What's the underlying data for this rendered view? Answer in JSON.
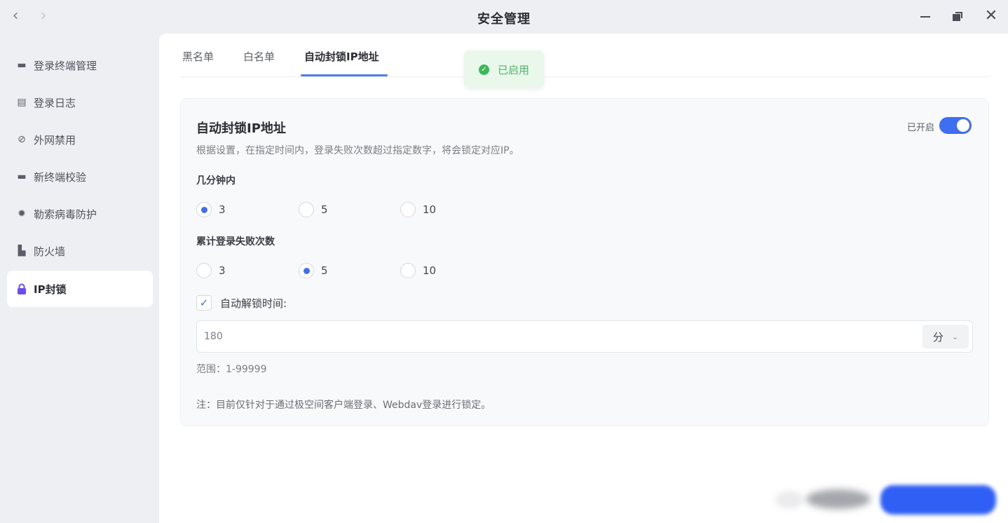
{
  "window": {
    "title": "安全管理",
    "back_icon": "‹",
    "forward_icon": "›",
    "close_icon": "✕"
  },
  "sidebar": {
    "items": [
      {
        "label": "登录终端管理",
        "icon": "monitor-icon",
        "glyph": "▬"
      },
      {
        "label": "登录日志",
        "icon": "log-icon",
        "glyph": "▤"
      },
      {
        "label": "外网禁用",
        "icon": "ban-icon",
        "glyph": "⊘"
      },
      {
        "label": "新终端校验",
        "icon": "chat-icon",
        "glyph": "▬"
      },
      {
        "label": "勒索病毒防护",
        "icon": "virus-icon",
        "glyph": "✹"
      },
      {
        "label": "防火墙",
        "icon": "firewall-icon",
        "glyph": "▙"
      },
      {
        "label": "IP封锁",
        "icon": "lock-icon",
        "glyph": "🔒"
      }
    ],
    "active_index": 6
  },
  "tabs": [
    {
      "label": "黑名单"
    },
    {
      "label": "白名单"
    },
    {
      "label": "自动封锁IP地址"
    }
  ],
  "toast": {
    "text": "已启用",
    "check_glyph": "✓"
  },
  "card": {
    "title": "自动封锁IP地址",
    "description": "根据设置，在指定时间内，登录失败次数超过指定数字，将会锁定对应IP。",
    "switch_label": "已开启",
    "switch_on": true,
    "minutes": {
      "label": "几分钟内",
      "options": [
        "3",
        "5",
        "10"
      ],
      "selected": "3"
    },
    "failures": {
      "label": "累计登录失败次数",
      "options": [
        "3",
        "5",
        "10"
      ],
      "selected": "5"
    },
    "auto_unlock": {
      "label": "自动解锁时间:",
      "checked": true,
      "check_glyph": "✓",
      "value": "180",
      "unit": "分",
      "unit_chevron": "⌄"
    },
    "range": "范围：1-99999",
    "note": "注：目前仅针对于通过极空间客户端登录、Webdav登录进行锁定。"
  },
  "colors": {
    "accent": "#3e6ff2",
    "toast_bg": "#e9f8ea",
    "toast_text": "#52b36a",
    "active_icon": "#6a4cf0"
  }
}
